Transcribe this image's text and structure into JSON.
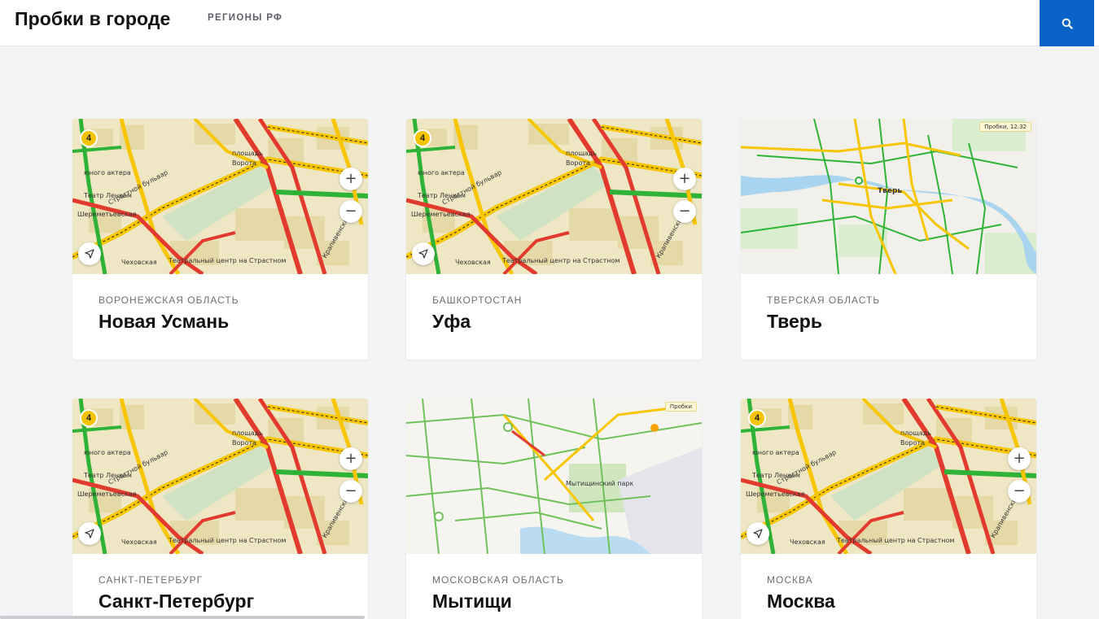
{
  "header": {
    "title": "Пробки в городе",
    "nav_regions": "РЕГИОНЫ РФ",
    "accent_color": "#0a63c7"
  },
  "cards": [
    {
      "region": "ВОРОНЕЖСКАЯ ОБЛАСТЬ",
      "city": "Новая Усмань",
      "map_type": "city-center",
      "traffic_level": "4",
      "map_labels": [
        "площадь",
        "Ворота",
        "юного актера",
        "Театр Ленком",
        "Шереметьевская",
        "Страстной бульвар",
        "Театральный центр на Страстном",
        "Чеховская",
        "Крапивенский"
      ]
    },
    {
      "region": "БАШКОРТОСТАН",
      "city": "Уфа",
      "map_type": "city-center",
      "traffic_level": "4",
      "map_labels": [
        "площадь",
        "Ворота",
        "юного актера",
        "Театр Ленком",
        "Шереметьевская",
        "Страстной бульвар",
        "Театральный центр на Страстном",
        "Чеховская",
        "Крапивенский"
      ]
    },
    {
      "region": "ТВЕРСКАЯ ОБЛАСТЬ",
      "city": "Тверь",
      "map_type": "river-city",
      "badge": "Пробки, 12:32",
      "map_labels": [
        "Тверь"
      ]
    },
    {
      "region": "САНКТ-ПЕТЕРБУРГ",
      "city": "Санкт-Петербург",
      "map_type": "city-center",
      "traffic_level": "4",
      "map_labels": [
        "площадь",
        "Ворота",
        "юного актера",
        "Театр Ленком",
        "Шереметьевская",
        "Страстной бульвар",
        "Театральный центр на Страстном",
        "Чеховская",
        "Крапивенский"
      ]
    },
    {
      "region": "МОСКОВСКАЯ ОБЛАСТЬ",
      "city": "Мытищи",
      "map_type": "suburb",
      "badge": "Пробки",
      "map_labels": [
        "Мытищинский парк"
      ]
    },
    {
      "region": "МОСКВА",
      "city": "Москва",
      "map_type": "city-center",
      "traffic_level": "4",
      "map_labels": [
        "площадь",
        "Ворота",
        "юного актера",
        "Театр Ленком",
        "Шереметьевская",
        "Страстной бульвар",
        "Театральный центр на Страстном",
        "Чеховская",
        "Крапивенский"
      ]
    }
  ],
  "icons": {
    "search": "search-icon",
    "zoom_in": "plus-icon",
    "zoom_out": "minus-icon",
    "locate": "navigation-arrow-icon"
  },
  "colors": {
    "traffic_green": "#2fb336",
    "traffic_yellow": "#f7c600",
    "traffic_red": "#e23b2e"
  }
}
